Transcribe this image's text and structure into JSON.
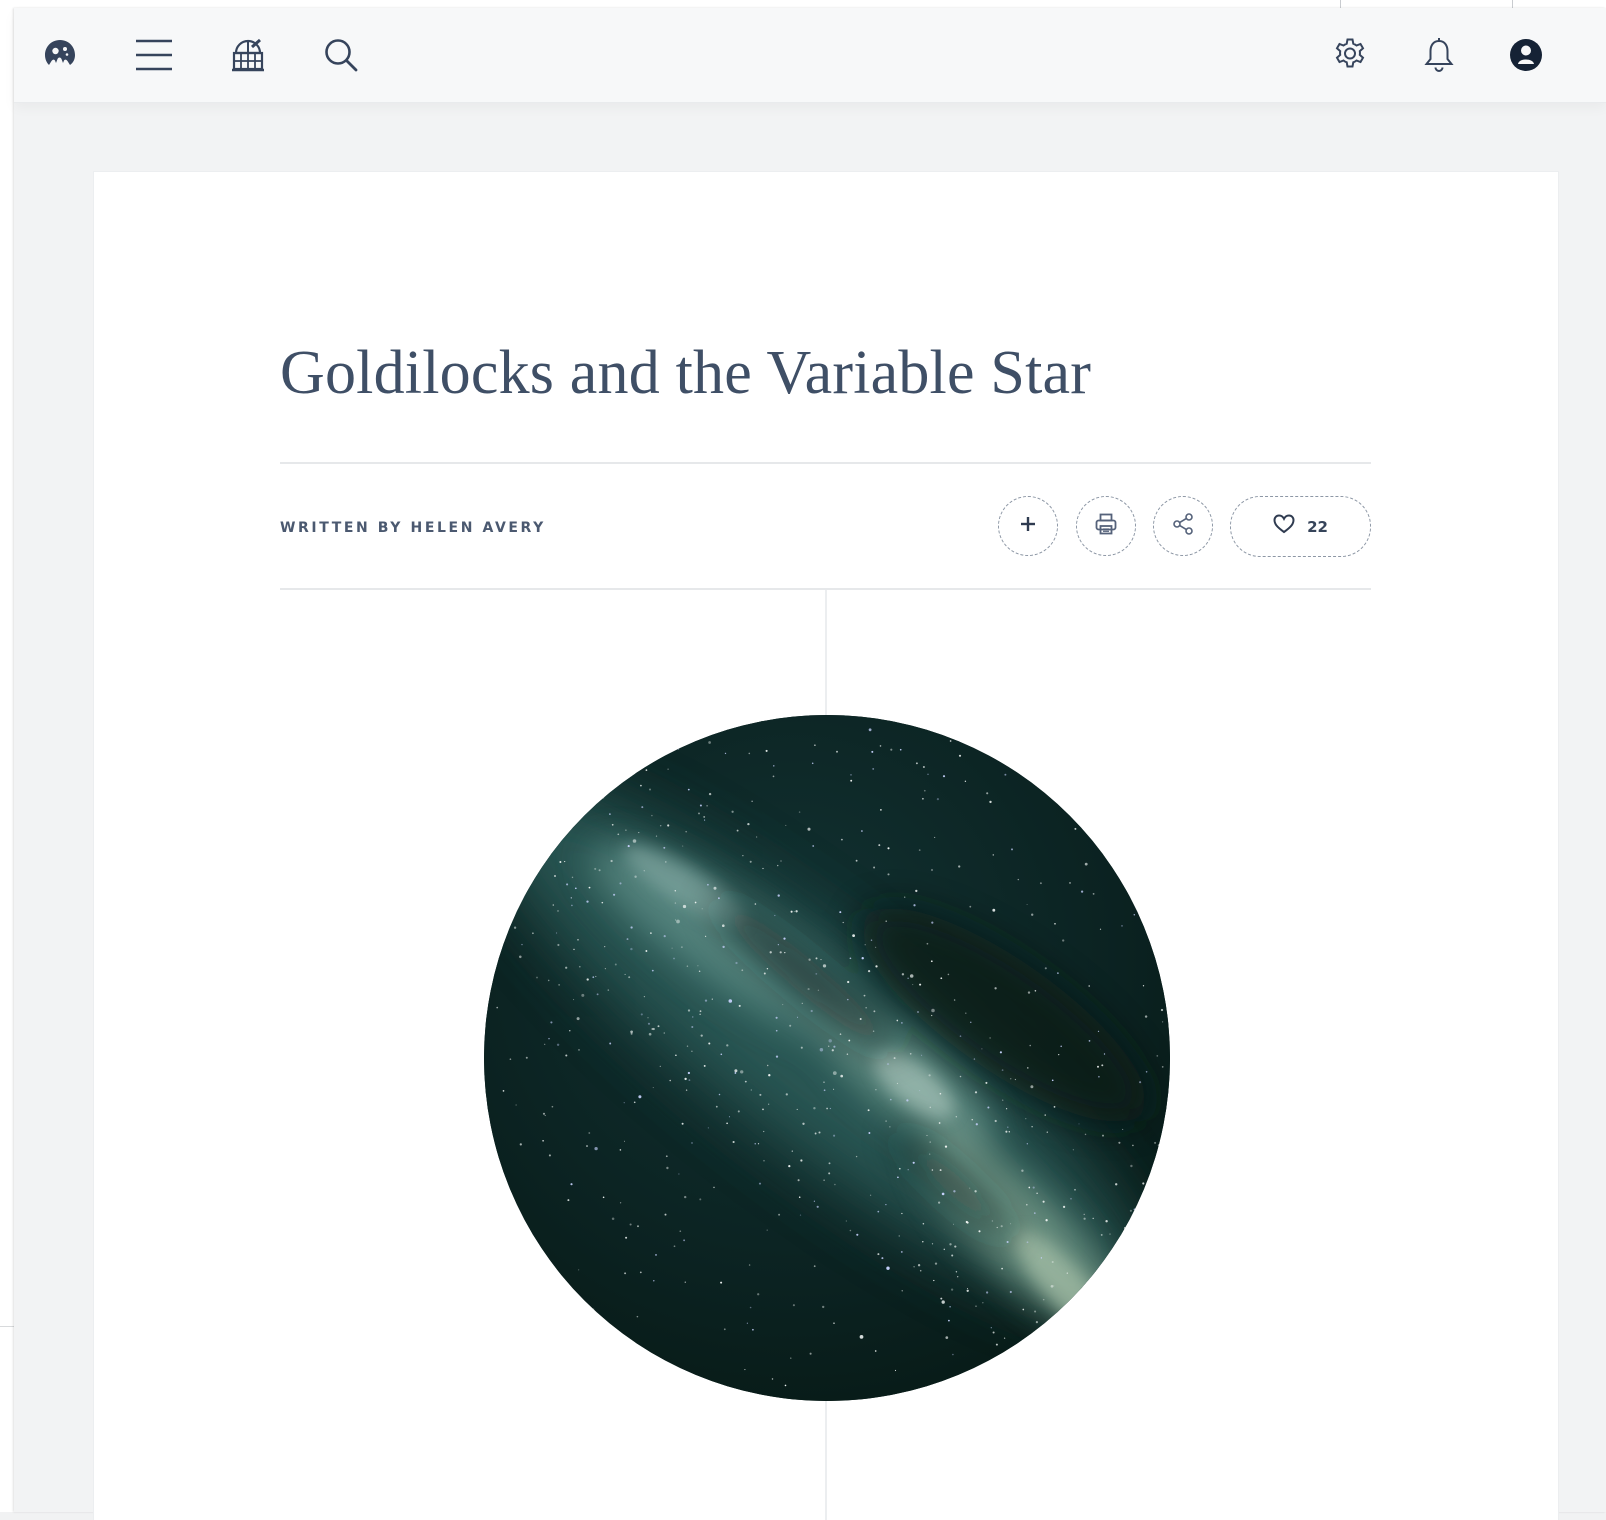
{
  "topbar": {
    "left_icons": [
      "logo-icon",
      "menu-icon",
      "observatory-icon",
      "search-icon"
    ],
    "right_icons": [
      "gear-icon",
      "bell-icon",
      "user-icon"
    ]
  },
  "article": {
    "title": "Goldilocks and the Variable Star",
    "byline": "WRITTEN BY HELEN AVERY",
    "actions": {
      "add_icon": "plus-icon",
      "print_icon": "printer-icon",
      "share_icon": "share-icon",
      "like_icon": "heart-icon",
      "like_count": "22"
    },
    "hero_image": "milky-way-night-sky"
  },
  "colors": {
    "ink": "#3f4f66",
    "icon": "#3c4b63",
    "background": "#f2f3f4",
    "card": "#ffffff",
    "hero_dark": "#0a1d1a",
    "hero_glow": "#8fb0a6"
  }
}
